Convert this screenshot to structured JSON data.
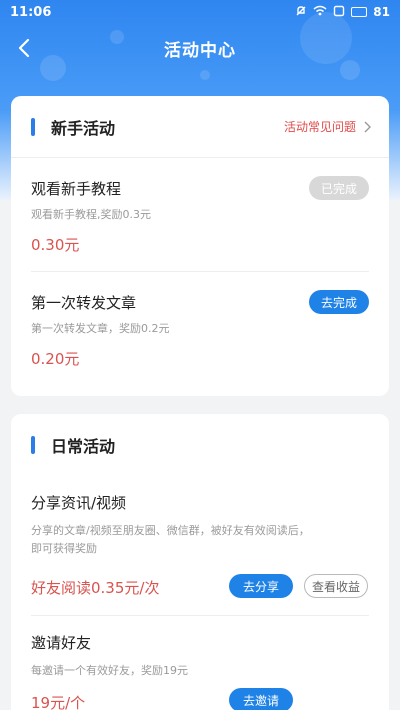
{
  "status_bar": {
    "time": "11:06",
    "battery": "81"
  },
  "nav": {
    "title": "活动中心"
  },
  "newbie": {
    "title": "新手活动",
    "faq_label": "活动常见问题",
    "items": [
      {
        "title": "观看新手教程",
        "desc": "观看新手教程,奖励0.3元",
        "reward": "0.30元",
        "button": "已完成"
      },
      {
        "title": "第一次转发文章",
        "desc": "第一次转发文章，奖励0.2元",
        "reward": "0.20元",
        "button": "去完成"
      }
    ]
  },
  "daily": {
    "title": "日常活动",
    "items": [
      {
        "title": "分享资讯/视频",
        "desc_line1": "分享的文章/视频至朋友圈、微信群，被好友有效阅读后，",
        "desc_line2": "即可获得奖励",
        "reward": "好友阅读0.35元/次",
        "button_primary": "去分享",
        "button_secondary": "查看收益"
      },
      {
        "title": "邀请好友",
        "desc": "每邀请一个有效好友，奖励19元",
        "reward": "19元/个",
        "button_primary": "去邀请"
      }
    ]
  },
  "colors": {
    "accent": "#1f82e6",
    "reward": "#d9534f",
    "faq": "#e14a4a"
  }
}
